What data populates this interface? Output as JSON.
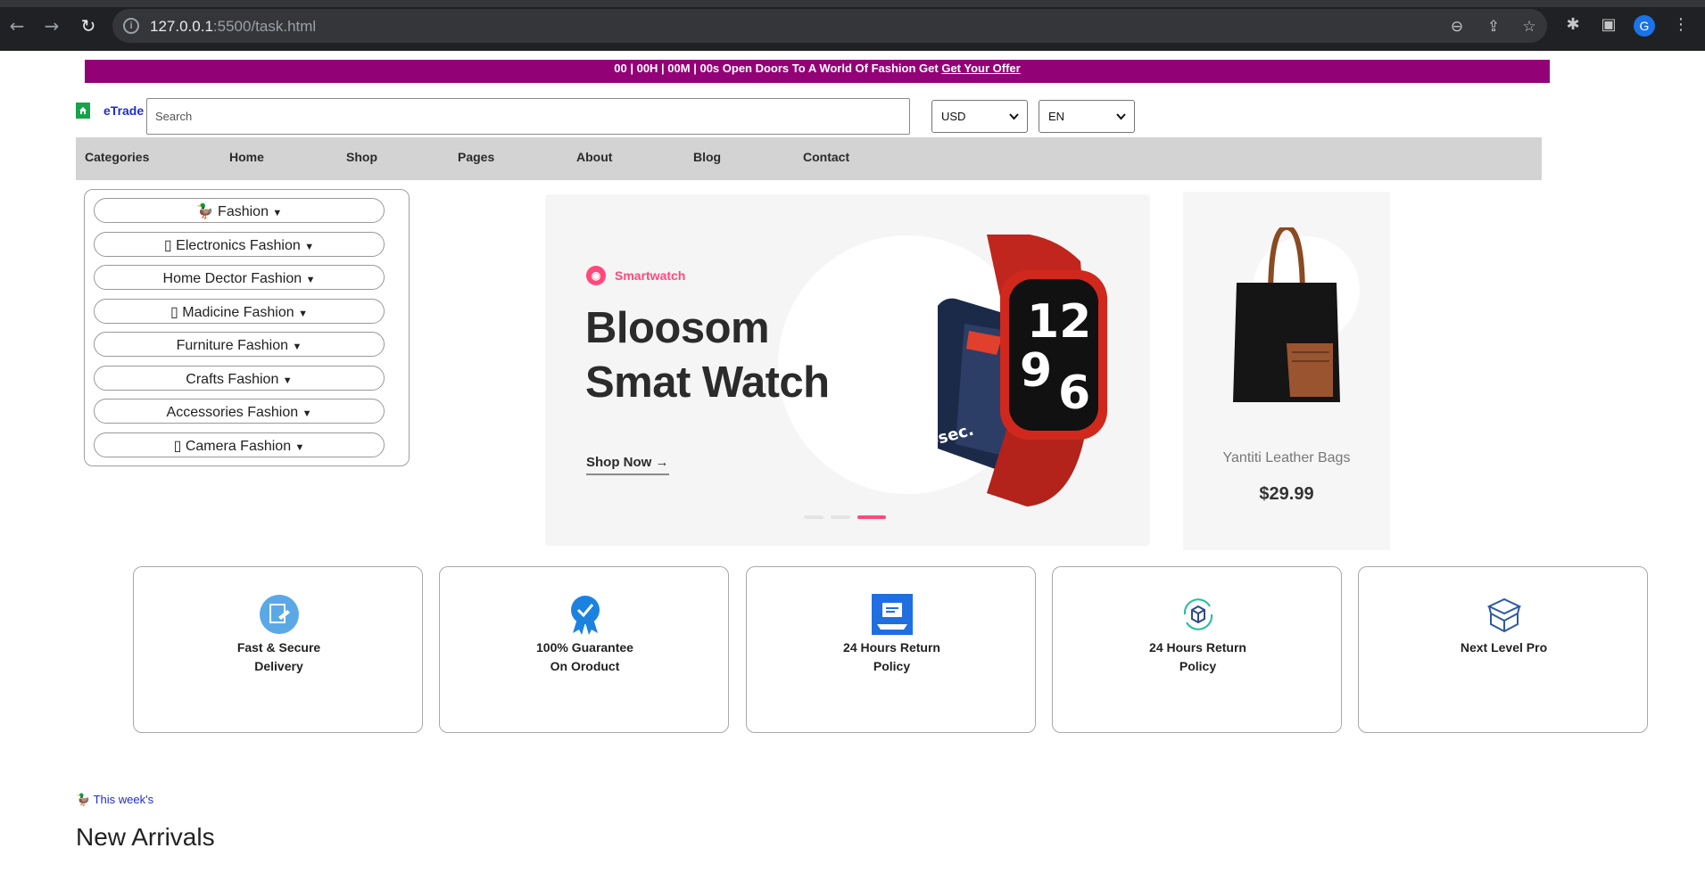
{
  "browser": {
    "url_host": "127.0.0.1",
    "url_rest": ":5500/task.html",
    "profile_initial": "G"
  },
  "promo": {
    "text": "00 | 00H | 00M | 00s Open Doors To A World Of Fashion Get ",
    "link": "Get Your Offer"
  },
  "header": {
    "brand": "eTrade",
    "search_placeholder": "Search",
    "currency": "USD",
    "language": "EN"
  },
  "nav": {
    "items": [
      "Categories",
      "Home",
      "Shop",
      "Pages",
      "About",
      "Blog",
      "Contact"
    ]
  },
  "categories": [
    {
      "label": "🦆 Fashion"
    },
    {
      "label": "▯ Electronics Fashion"
    },
    {
      "label": "Home Dector Fashion"
    },
    {
      "label": "▯ Madicine Fashion"
    },
    {
      "label": "Furniture Fashion"
    },
    {
      "label": "Crafts Fashion"
    },
    {
      "label": "Accessories Fashion"
    },
    {
      "label": "▯ Camera Fashion"
    }
  ],
  "hero": {
    "tag": "Smartwatch",
    "title_line1": "Bloosom",
    "title_line2": "Smat Watch",
    "cta": "Shop Now",
    "slide_count": 3,
    "active_slide": 3
  },
  "product": {
    "name": "Yantiti Leather Bags",
    "price": "$29.99"
  },
  "features": [
    {
      "line1": "Fast & Secure",
      "line2": "Delivery",
      "icon": "delivery-icon"
    },
    {
      "line1": "100% Guarantee",
      "line2": "On Oroduct",
      "icon": "badge-icon"
    },
    {
      "line1": "24 Hours Return",
      "line2": "Policy",
      "icon": "return-policy-icon"
    },
    {
      "line1": "24 Hours Return",
      "line2": "Policy",
      "icon": "cycle-box-icon"
    },
    {
      "line1": "Next Level Pro",
      "line2": "",
      "icon": "box-icon"
    }
  ],
  "section": {
    "kicker": "🦆 This week's",
    "title": "New Arrivals"
  },
  "colors": {
    "promo_bg": "#930177",
    "accent_pink": "#ff497c",
    "nav_bg": "#d3d3d3",
    "link_blue": "#1f2bd8"
  }
}
